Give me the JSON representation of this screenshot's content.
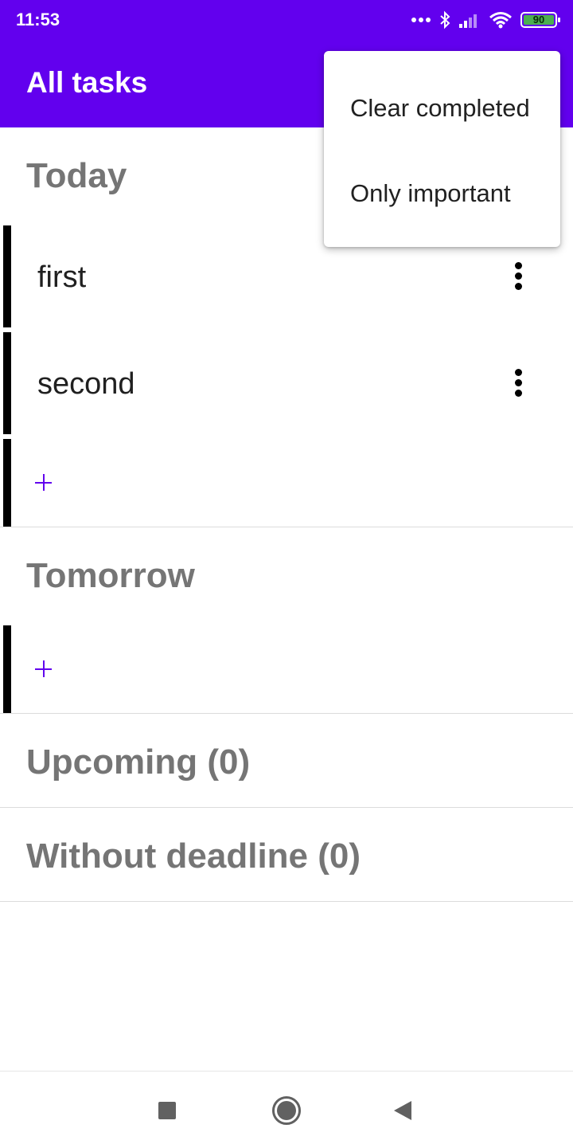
{
  "status_bar": {
    "time": "11:53",
    "battery": "90"
  },
  "app_bar": {
    "title": "All tasks"
  },
  "sections": {
    "today": {
      "title": "Today",
      "tasks": [
        {
          "label": "first"
        },
        {
          "label": "second"
        }
      ],
      "add_label": "+"
    },
    "tomorrow": {
      "title": "Tomorrow",
      "add_label": "+"
    },
    "upcoming": {
      "title": "Upcoming (0)"
    },
    "without_deadline": {
      "title": "Without deadline (0)"
    }
  },
  "overflow_menu": {
    "items": [
      {
        "label": "Clear completed"
      },
      {
        "label": "Only important"
      }
    ]
  },
  "nav_bar": {
    "icons": [
      "recents-square-icon",
      "home-circle-icon",
      "back-triangle-icon"
    ]
  },
  "colors": {
    "primary": "#6200ee",
    "section_text": "#757575",
    "battery": "#4caf50"
  }
}
